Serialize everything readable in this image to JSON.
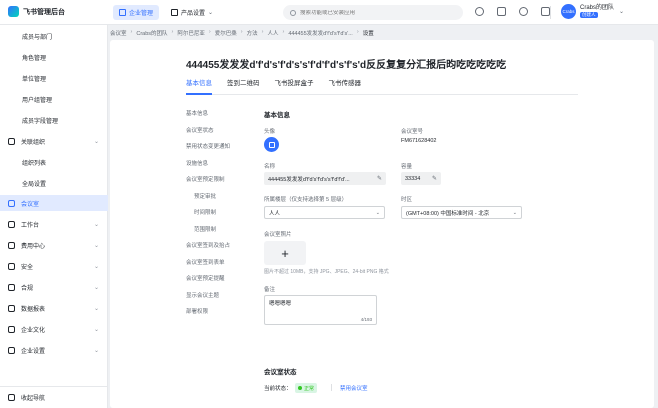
{
  "app": {
    "title": "飞书管理后台"
  },
  "topnav": {
    "items": [
      "企业管理",
      "产品设置"
    ]
  },
  "search": {
    "placeholder": "搜索功能或已安装应用"
  },
  "user": {
    "avatar_text": "Crabs",
    "name": "Crabs的团队",
    "role": "创建人"
  },
  "sidebar": {
    "items": [
      {
        "label": "成员与部门",
        "type": "sub"
      },
      {
        "label": "角色管理",
        "type": "sub"
      },
      {
        "label": "单位管理",
        "type": "sub"
      },
      {
        "label": "用户组管理",
        "type": "sub"
      },
      {
        "label": "成员字段管理",
        "type": "sub"
      },
      {
        "label": "关联组织",
        "type": "grp",
        "chevron": "⌄"
      },
      {
        "label": "组织列表",
        "type": "sub"
      },
      {
        "label": "全局设置",
        "type": "sub"
      },
      {
        "label": "会议室",
        "type": "grp",
        "active": true
      },
      {
        "label": "工作台",
        "type": "grp",
        "chevron": "⌄"
      },
      {
        "label": "费用中心",
        "type": "grp",
        "chevron": "⌄"
      },
      {
        "label": "安全",
        "type": "grp",
        "chevron": "⌄"
      },
      {
        "label": "合规",
        "type": "grp",
        "chevron": "⌄"
      },
      {
        "label": "数据报表",
        "type": "grp",
        "chevron": "⌄"
      },
      {
        "label": "企业文化",
        "type": "grp",
        "chevron": "⌄"
      },
      {
        "label": "企业设置",
        "type": "grp",
        "chevron": "⌄"
      }
    ],
    "footer": "收起导航"
  },
  "breadcrumb": [
    "会议室",
    "Crabs的团队",
    "阿尔巴尼亚",
    "爱尔巴桑",
    "方法",
    "人人",
    "444455发发发d'f'd's'f'd's'...",
    "设置"
  ],
  "page": {
    "title": "444455发发发d'f'd's'f'd's's'f'd'f'd's'f's'd反反复复分汇报后昀吃吃吃吃吃",
    "tabs": [
      "基本信息",
      "签到二维码",
      "飞书投屏盒子",
      "飞书传感器"
    ]
  },
  "anchors": [
    {
      "label": "基本信息",
      "sub": false
    },
    {
      "label": "会议室状态",
      "sub": false
    },
    {
      "label": "禁用状态变更通知",
      "sub": false
    },
    {
      "label": "设施信息",
      "sub": false
    },
    {
      "label": "会议室预定限制",
      "sub": false
    },
    {
      "label": "预定审批",
      "sub": true
    },
    {
      "label": "时间限制",
      "sub": true
    },
    {
      "label": "范围限制",
      "sub": true
    },
    {
      "label": "会议室签到及抬占",
      "sub": false
    },
    {
      "label": "会议室签到表单",
      "sub": false
    },
    {
      "label": "会议室预定提醒",
      "sub": false
    },
    {
      "label": "显示会议主题",
      "sub": false
    },
    {
      "label": "部署权限",
      "sub": false
    }
  ],
  "basic": {
    "section_title": "基本信息",
    "cover_label": "头像",
    "id_label": "会议室号",
    "id_value": "FM671628402",
    "name_label": "名称",
    "name_value": "444455发发发d'f'd's'f'd's's'f'd'f'd'...",
    "capacity_label": "容量",
    "capacity_value": "33334",
    "floor_label": "所属楼层（仅支持选择第 5 层级）",
    "floor_value": "人人",
    "tz_label": "时区",
    "tz_value": "(GMT+08:00) 中国标准时间 - 北京",
    "photo_label": "会议室照片",
    "photo_plus": "+",
    "photo_hint": "图片不超过 10MB，支持 JPG、JPEG、24-bit PNG 格式",
    "remark_label": "备注",
    "remark_value": "嗯嗯嗯嗯",
    "remark_counter": "4/193"
  },
  "status": {
    "section_title": "会议室状态",
    "current_label": "当前状态：",
    "badge": "正常",
    "disable_link": "禁用会议室"
  }
}
